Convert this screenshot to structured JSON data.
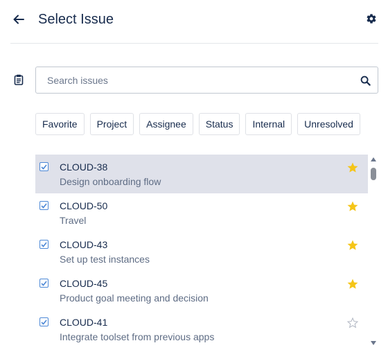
{
  "header": {
    "title": "Select Issue",
    "back_icon": "arrow-left-icon",
    "settings_icon": "gear-icon"
  },
  "search": {
    "placeholder": "Search issues",
    "value": "",
    "icon": "search-icon",
    "leading_icon": "clipboard-icon"
  },
  "filters": [
    "Favorite",
    "Project",
    "Assignee",
    "Status",
    "Internal",
    "Unresolved"
  ],
  "issues": [
    {
      "key": "CLOUD-38",
      "summary": "Design onboarding flow",
      "checked": true,
      "starred": true,
      "selected": true
    },
    {
      "key": "CLOUD-50",
      "summary": "Travel",
      "checked": true,
      "starred": true,
      "selected": false
    },
    {
      "key": "CLOUD-43",
      "summary": "Set up test instances",
      "checked": true,
      "starred": true,
      "selected": false
    },
    {
      "key": "CLOUD-45",
      "summary": "Product goal meeting and decision",
      "checked": true,
      "starred": true,
      "selected": false
    },
    {
      "key": "CLOUD-41",
      "summary": "Integrate toolset from previous apps",
      "checked": true,
      "starred": false,
      "selected": false
    }
  ],
  "colors": {
    "accent": "#4c88d6",
    "star": "#f5c518",
    "selected_row": "#dfe1ea",
    "text": "#172b4d",
    "muted": "#5e6c84"
  }
}
